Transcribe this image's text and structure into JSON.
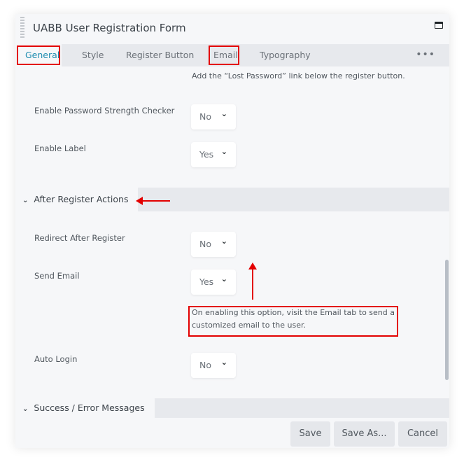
{
  "window": {
    "title": "UABB User Registration Form",
    "maximize_icon": "window-maximize-icon",
    "grip_icon": "drag-handle-icon"
  },
  "tabs": [
    {
      "label": "General",
      "active": true,
      "highlighted": true
    },
    {
      "label": "Style",
      "active": false,
      "highlighted": false
    },
    {
      "label": "Register Button",
      "active": false,
      "highlighted": false
    },
    {
      "label": "Email",
      "active": false,
      "highlighted": true
    },
    {
      "label": "Typography",
      "active": false,
      "highlighted": false
    }
  ],
  "more_label": "•••",
  "fields": {
    "lost_password_desc": "Add the “Lost Password” link below the register button.",
    "password_strength": {
      "label": "Enable Password Strength Checker",
      "value": "No"
    },
    "enable_label": {
      "label": "Enable Label",
      "value": "Yes"
    }
  },
  "sections": {
    "after_register": {
      "title": "After Register Actions",
      "fields": {
        "redirect": {
          "label": "Redirect After Register",
          "value": "No"
        },
        "send_email": {
          "label": "Send Email",
          "value": "Yes",
          "description": "On enabling this option, visit the Email tab to send a customized email to the user."
        },
        "auto_login": {
          "label": "Auto Login",
          "value": "No"
        }
      }
    },
    "success_error": {
      "title": "Success / Error Messages"
    }
  },
  "chevron_glyph": "⌄",
  "footer": {
    "save_label": "Save",
    "save_as_label": "Save As...",
    "cancel_label": "Cancel"
  },
  "colors": {
    "accent": "#1f8db0",
    "annotation_red": "#e30000",
    "panel_bg": "#f6f7f9",
    "tab_bar_bg": "#e7e9ed"
  }
}
